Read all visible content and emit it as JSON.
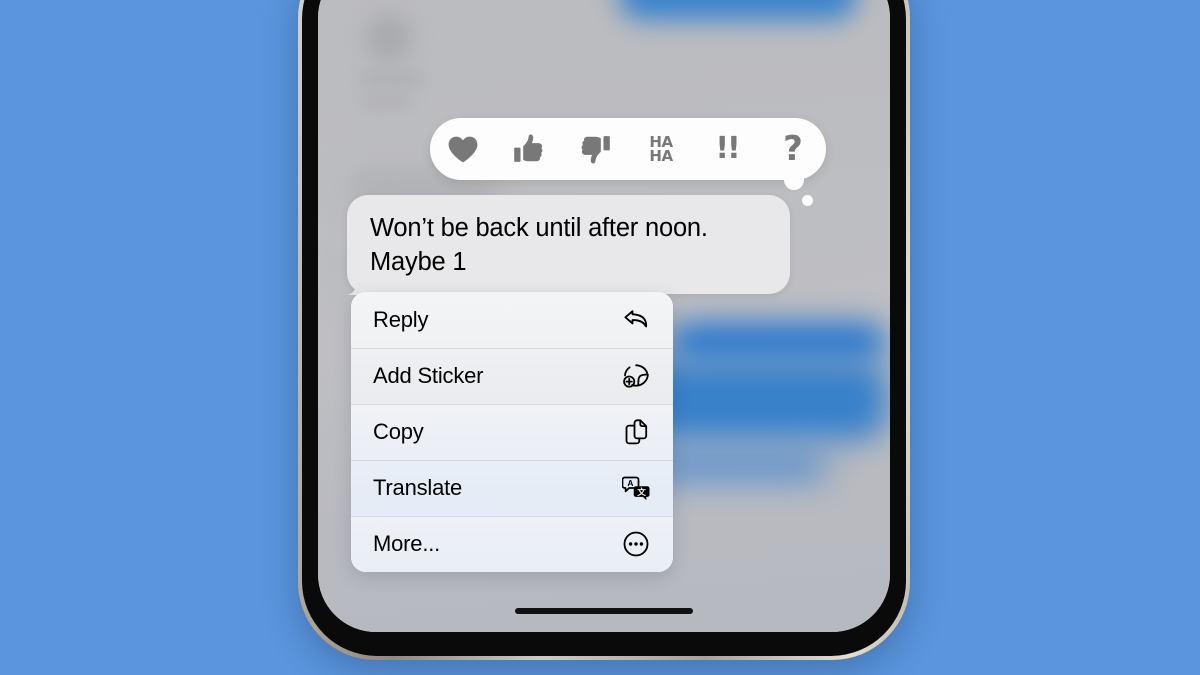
{
  "scene": {
    "background_color": "#5a95de",
    "device": "iphone",
    "app": "Messages"
  },
  "tapback": {
    "name": "reaction-bar",
    "options": [
      {
        "id": "heart",
        "label": "Heart",
        "icon": "heart-icon"
      },
      {
        "id": "thumbs-up",
        "label": "Thumbs Up",
        "icon": "thumbs-up-icon"
      },
      {
        "id": "thumbs-down",
        "label": "Thumbs Down",
        "icon": "thumbs-down-icon"
      },
      {
        "id": "haha",
        "label": "HA HA",
        "icon": "haha-icon",
        "line1": "HA",
        "line2": "HA"
      },
      {
        "id": "exclaim",
        "label": "!!",
        "icon": "exclamation-icon",
        "glyph": "!!"
      },
      {
        "id": "question",
        "label": "?",
        "icon": "question-icon",
        "glyph": "?"
      }
    ]
  },
  "message": {
    "text": "Won’t be back until after noon. Maybe 1",
    "sender": "incoming",
    "bubble_color": "#e8e8ea"
  },
  "context_menu": {
    "items": [
      {
        "label": "Reply",
        "icon": "reply-arrow-icon"
      },
      {
        "label": "Add Sticker",
        "icon": "add-sticker-icon"
      },
      {
        "label": "Copy",
        "icon": "copy-icon"
      },
      {
        "label": "Translate",
        "icon": "translate-icon"
      },
      {
        "label": "More...",
        "icon": "more-circle-icon"
      }
    ]
  },
  "translate_icon": {
    "latin_glyph": "A",
    "cjk_glyph": "文"
  }
}
